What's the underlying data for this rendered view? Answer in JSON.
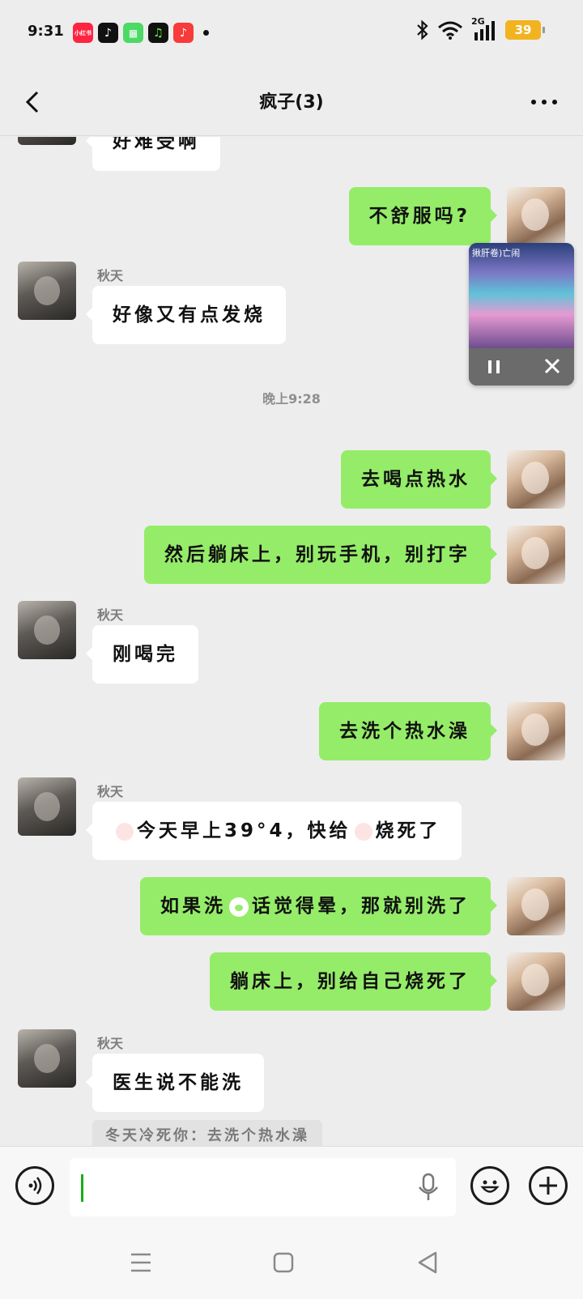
{
  "status_bar": {
    "time": "9:31",
    "apps": [
      "小红书",
      "tiktok-icon",
      "grid-app-icon",
      "music-app-icon",
      "music-note-icon"
    ],
    "app_label_xhs": "小红书",
    "network": "2G",
    "battery": "39"
  },
  "header": {
    "title": "疯子(3)",
    "back_icon": "chevron-left-icon",
    "more_icon": "more-dots-icon"
  },
  "mini_player": {
    "title": "揪肝卷)亡闹",
    "pause_icon": "pause-icon",
    "close_icon": "close-icon"
  },
  "messages": [
    {
      "side": "other",
      "text": "好难受啊"
    },
    {
      "side": "me",
      "text": "不舒服吗?"
    },
    {
      "side": "other",
      "sender": "秋天",
      "text": "好像又有点发烧"
    },
    {
      "type": "time",
      "text": "晚上9:28"
    },
    {
      "side": "me",
      "text": "去喝点热水"
    },
    {
      "side": "me",
      "text": "然后躺床上，别玩手机，别打字"
    },
    {
      "side": "other",
      "sender": "秋天",
      "text": "刚喝完"
    },
    {
      "side": "me",
      "text": "去洗个热水澡"
    },
    {
      "side": "other",
      "sender": "秋天",
      "text_a": "今天早上39°4，快给",
      "text_b": "烧死了"
    },
    {
      "side": "me",
      "text_a": "如果洗",
      "text_b": "话觉得晕，那就别洗了"
    },
    {
      "side": "me",
      "text": "躺床上，别给自己烧死了"
    },
    {
      "side": "other",
      "sender": "秋天",
      "text": "医生说不能洗"
    }
  ],
  "quote": "冬天冷死你：去洗个热水澡",
  "input_bar": {
    "value": "",
    "voice_icon": "voice-icon",
    "mic_icon": "microphone-icon",
    "emoji_icon": "emoji-icon",
    "plus_icon": "plus-icon"
  },
  "nav_bar": {
    "menu_icon": "menu-icon",
    "home_icon": "home-square-icon",
    "back_icon": "back-triangle-icon"
  },
  "colors": {
    "background": "#ededed",
    "my_bubble": "#95ec69",
    "other_bubble": "#ffffff",
    "battery": "#f2b320"
  }
}
